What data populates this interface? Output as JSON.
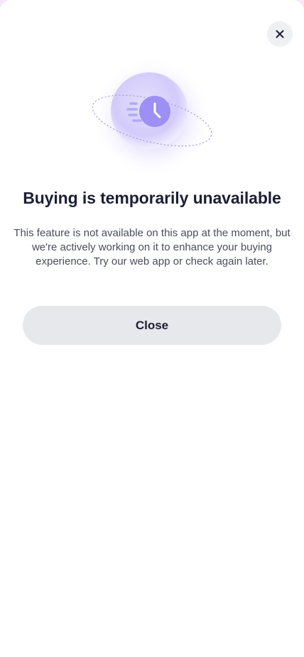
{
  "modal": {
    "title": "Buying is temporarily unavailable",
    "message": "This feature is not available on this app at the moment, but we're actively working on it to enhance your buying experience. Try our web app or check again later.",
    "close_button_label": "Close",
    "close_icon": "close-icon",
    "illustration_icon": "clock-icon"
  },
  "colors": {
    "accent": "#9d8ff5",
    "title": "#1c1f33",
    "body": "#4a4d5c",
    "button_bg": "#e7e8ec"
  }
}
